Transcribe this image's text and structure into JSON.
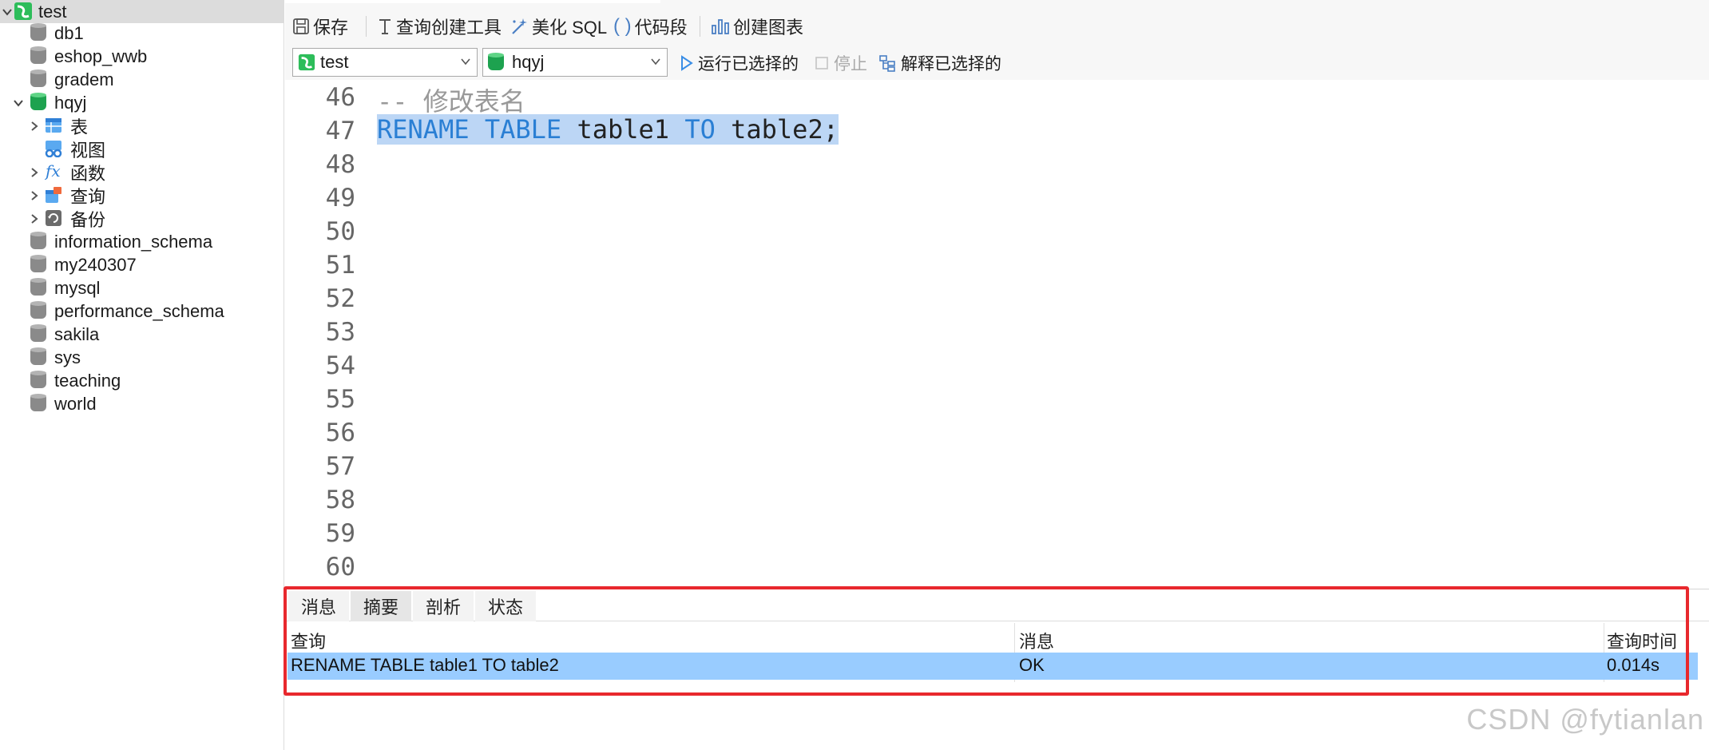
{
  "sidebar": {
    "items": [
      {
        "label": "test",
        "icon": "connection-icon",
        "expanded": true,
        "selected": true
      },
      {
        "label": "db1",
        "icon": "database-icon"
      },
      {
        "label": "eshop_wwb",
        "icon": "database-icon"
      },
      {
        "label": "gradem",
        "icon": "database-icon"
      },
      {
        "label": "hqyj",
        "icon": "database-icon",
        "expanded": true,
        "active": true
      },
      {
        "label": "表",
        "icon": "table-icon",
        "child": true
      },
      {
        "label": "视图",
        "icon": "view-icon",
        "child": true
      },
      {
        "label": "函数",
        "icon": "function-icon",
        "child": true
      },
      {
        "label": "查询",
        "icon": "query-icon",
        "child": true
      },
      {
        "label": "备份",
        "icon": "backup-icon",
        "child": true
      },
      {
        "label": "information_schema",
        "icon": "database-icon"
      },
      {
        "label": "my240307",
        "icon": "database-icon"
      },
      {
        "label": "mysql",
        "icon": "database-icon"
      },
      {
        "label": "performance_schema",
        "icon": "database-icon"
      },
      {
        "label": "sakila",
        "icon": "database-icon"
      },
      {
        "label": "sys",
        "icon": "database-icon"
      },
      {
        "label": "teaching",
        "icon": "database-icon"
      },
      {
        "label": "world",
        "icon": "database-icon"
      }
    ]
  },
  "toolbar": {
    "save": "保存",
    "query_builder": "查询创建工具",
    "beautify": "美化 SQL",
    "snippet": "代码段",
    "create_chart": "创建图表"
  },
  "selectors": {
    "connection": "test",
    "database": "hqyj",
    "run_selected": "运行已选择的",
    "stop": "停止",
    "explain_selected": "解释已选择的"
  },
  "editor": {
    "line_numbers": [
      "46",
      "47",
      "48",
      "49",
      "50",
      "51",
      "52",
      "53",
      "54",
      "55",
      "56",
      "57",
      "58",
      "59",
      "60"
    ],
    "line46": "-- 修改表名",
    "line47_kw1": "RENAME TABLE",
    "line47_id1": "table1",
    "line47_kw2": "TO",
    "line47_id2": "table2;"
  },
  "results": {
    "tabs": [
      "消息",
      "摘要",
      "剖析",
      "状态"
    ],
    "active_tab": "摘要",
    "columns": [
      "查询",
      "消息",
      "查询时间"
    ],
    "row": {
      "query": "RENAME TABLE table1 TO table2",
      "message": "OK",
      "time": "0.014s"
    }
  },
  "watermark": "CSDN @fytianlan",
  "colors": {
    "selection_row": "#99ccff",
    "highlight_border": "#e8282d",
    "keyword": "#2a7fd4",
    "comment": "#999999",
    "db_active": "#1da24f"
  }
}
